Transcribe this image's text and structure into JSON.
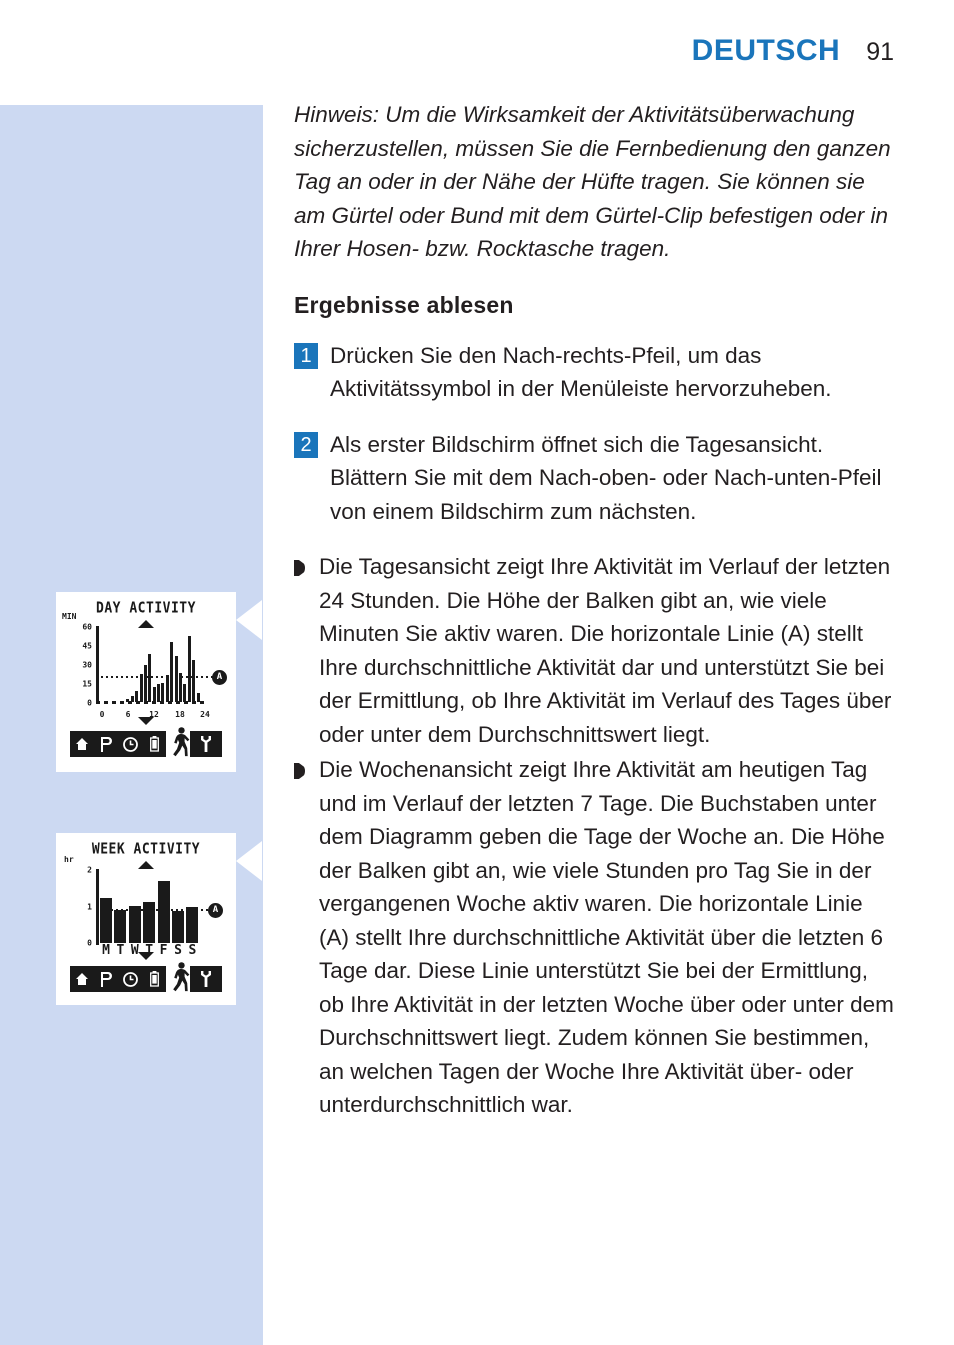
{
  "header": {
    "language": "DEUTSCH",
    "page_number": "91"
  },
  "colors": {
    "accent_blue": "#1a75bb",
    "band_blue": "#ccd9f2",
    "ink": "#231f20"
  },
  "content": {
    "note": "Hinweis: Um die Wirksamkeit der Aktivitätsüberwachung sicherzustellen, müssen Sie die Fernbedienung den ganzen Tag an oder in der Nähe der Hüfte tragen. Sie können sie am Gürtel oder Bund mit dem Gürtel-Clip befestigen oder in Ihrer Hosen- bzw. Rocktasche tragen.",
    "section_title": "Ergebnisse ablesen",
    "steps": [
      {
        "number": "1",
        "text": "Drücken Sie den Nach-rechts-Pfeil, um das Aktivitätssymbol in der Menüleiste hervorzuheben."
      },
      {
        "number": "2",
        "text": " Als erster Bildschirm öffnet sich die Tagesansicht. Blättern Sie mit dem Nach-oben- oder Nach-unten-Pfeil von einem Bildschirm zum nächsten."
      }
    ],
    "bullets": [
      "Die Tagesansicht zeigt Ihre Aktivität im Verlauf der letzten 24 Stunden. Die Höhe der Balken gibt an, wie viele Minuten Sie aktiv waren. Die horizontale Linie (A) stellt Ihre durchschnittliche Aktivität dar und unterstützt Sie bei der Ermittlung, ob Ihre Aktivität im Verlauf des Tages über oder unter dem Durchschnittswert liegt.",
      "Die Wochenansicht zeigt Ihre Aktivität am heutigen Tag und im Verlauf der letzten 7 Tage. Die Buchstaben unter dem Diagramm geben die Tage der Woche an. Die Höhe der Balken gibt an, wie viele Stunden pro Tag Sie in der vergangenen Woche aktiv waren. Die horizontale Linie (A) stellt Ihre durchschnittliche Aktivität über die letzten 6 Tage dar. Diese Linie unterstützt Sie bei der Ermittlung, ob Ihre Aktivität in der letzten Woche über oder unter dem Durchschnittswert liegt. Zudem können Sie bestimmen, an welchen Tagen der Woche Ihre Aktivität über- oder unterdurchschnittlich war."
    ]
  },
  "device_screens": [
    {
      "id": "day",
      "title": "DAY ACTIVITY",
      "scroll_up_icon": "triangle-up-icon",
      "scroll_down_icon": "triangle-down-icon",
      "average_marker_label": "A",
      "menu_icons": [
        "home-icon",
        "p-icon",
        "clock-icon",
        "battery-icon",
        "walking-person-icon",
        "wrench-icon"
      ],
      "selected_menu_icon": "walking-person-icon"
    },
    {
      "id": "week",
      "title": "WEEK ACTIVITY",
      "scroll_up_icon": "triangle-up-icon",
      "scroll_down_icon": "triangle-down-icon",
      "average_marker_label": "A",
      "menu_icons": [
        "home-icon",
        "p-icon",
        "clock-icon",
        "battery-icon",
        "walking-person-icon",
        "wrench-icon"
      ],
      "selected_menu_icon": "walking-person-icon"
    }
  ],
  "chart_data": [
    {
      "type": "bar",
      "title": "DAY ACTIVITY",
      "xlabel": "",
      "ylabel": "MIN",
      "ylim": [
        0,
        60
      ],
      "yticks": [
        "0",
        "15",
        "30",
        "45",
        "60"
      ],
      "xticks": [
        "0",
        "6",
        "12",
        "18",
        "24"
      ],
      "x": [
        0,
        1,
        2,
        3,
        4,
        5,
        6,
        7,
        8,
        9,
        10,
        11,
        12,
        13,
        14,
        15,
        16,
        17,
        18,
        19,
        20,
        21,
        22,
        23
      ],
      "values": [
        0,
        0,
        0,
        0,
        0,
        0,
        2,
        5,
        9,
        22,
        29,
        38,
        12,
        14,
        15,
        21,
        47,
        36,
        23,
        14,
        52,
        33,
        7,
        1
      ],
      "average_line": 19,
      "average_label": "A",
      "grid": false,
      "legend": "none"
    },
    {
      "type": "bar",
      "title": "WEEK ACTIVITY",
      "xlabel": "",
      "ylabel": "hr",
      "ylim": [
        0,
        2
      ],
      "yticks": [
        "0",
        "1",
        "2"
      ],
      "categories": [
        "M",
        "T",
        "W",
        "T",
        "F",
        "S",
        "S"
      ],
      "values": [
        1.22,
        0.9,
        1.0,
        1.1,
        1.68,
        0.86,
        0.97
      ],
      "average_line": 1.1,
      "average_label": "A",
      "grid": false,
      "legend": "none"
    }
  ]
}
